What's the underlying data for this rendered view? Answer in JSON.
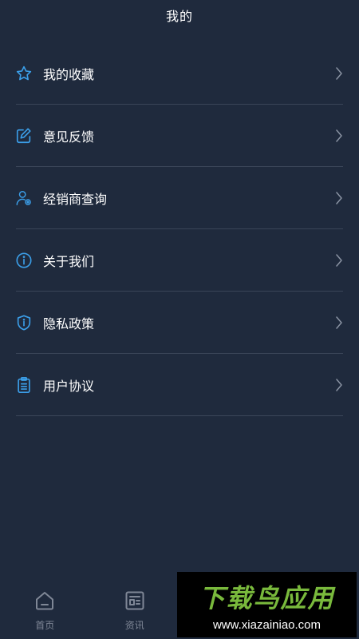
{
  "header": {
    "title": "我的"
  },
  "menu": {
    "items": [
      {
        "label": "我的收藏",
        "icon": "star-icon"
      },
      {
        "label": "意见反馈",
        "icon": "edit-icon"
      },
      {
        "label": "经销商查询",
        "icon": "dealer-search-icon"
      },
      {
        "label": "关于我们",
        "icon": "info-icon"
      },
      {
        "label": "隐私政策",
        "icon": "shield-icon"
      },
      {
        "label": "用户协议",
        "icon": "clipboard-icon"
      }
    ]
  },
  "tabbar": {
    "tabs": [
      {
        "label": "首页",
        "icon": "home-icon"
      },
      {
        "label": "资讯",
        "icon": "news-icon"
      }
    ]
  },
  "watermark": {
    "brand": "下载鸟应用",
    "url": "www.xiazainiao.com"
  },
  "colors": {
    "background": "#1f2a3d",
    "accent": "#3b9ee8",
    "divider": "#3a4558",
    "tab_inactive": "#7f8796",
    "watermark_green": "#79b93c"
  }
}
